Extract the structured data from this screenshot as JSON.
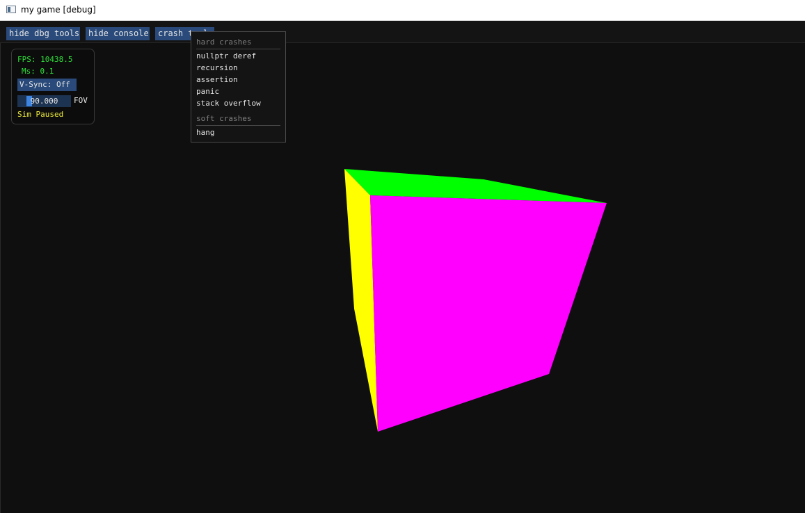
{
  "window": {
    "title": "my game [debug]",
    "icon": "app-window-icon"
  },
  "menubar": {
    "hide_dbg_tools": "hide dbg tools",
    "hide_console": "hide console",
    "crash_tools": "crash tools"
  },
  "stats": {
    "fps": "FPS: 10438.5",
    "ms": "Ms: 0.1",
    "vsync": "V-Sync: Off",
    "fov_value": "90.000",
    "fov_label": "FOV",
    "sim_status": "Sim Paused"
  },
  "crash_menu": {
    "hard_header": "hard crashes",
    "hard_items": [
      "nullptr deref",
      "recursion",
      "assertion",
      "panic",
      "stack overflow"
    ],
    "soft_header": "soft crashes",
    "soft_items": [
      "hang"
    ]
  },
  "cube": {
    "colors": {
      "top": "#00ff00",
      "left": "#ffff00",
      "front": "#ff00ff"
    }
  }
}
